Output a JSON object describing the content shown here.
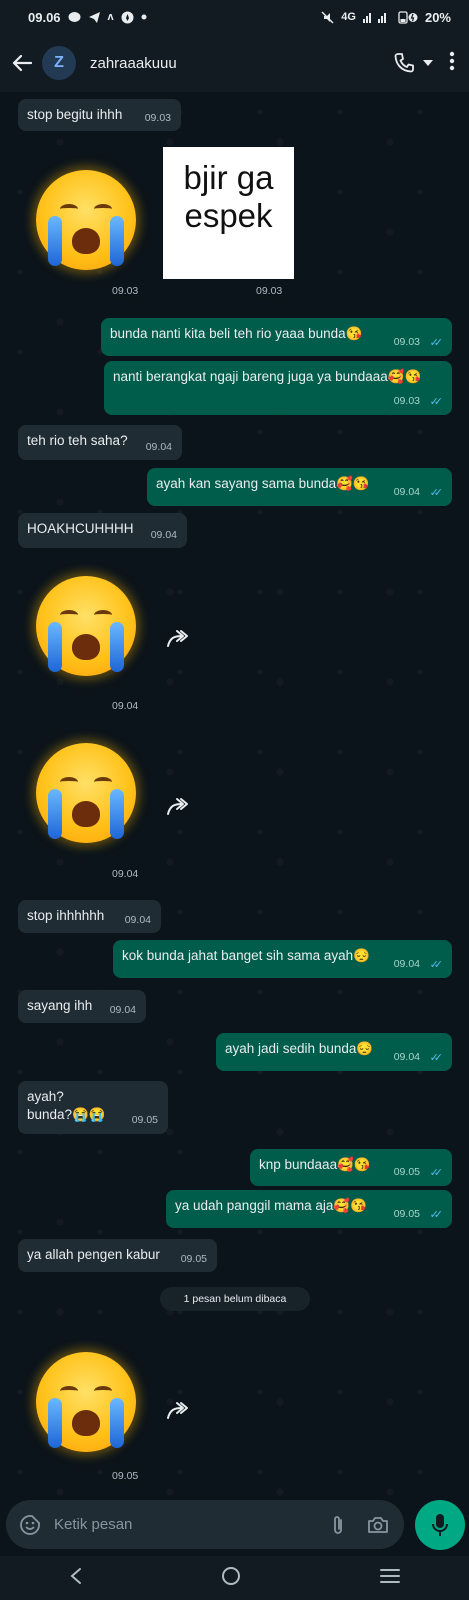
{
  "status_bar": {
    "time": "09.06",
    "network": "4G",
    "battery": "20%",
    "icons": [
      "chat-bubble-icon",
      "telegram-icon",
      "nfc-icon",
      "compass-icon",
      "dot-icon",
      "mute-icon",
      "signal-icon",
      "battery-icon"
    ]
  },
  "header": {
    "avatar_letter": "Z",
    "contact_name": "zahraaakuuu",
    "icons": [
      "back-arrow-icon",
      "phone-icon",
      "dropdown-icon",
      "more-vert-icon"
    ]
  },
  "sticker": {
    "line1": "bjir ga",
    "line2": "espek"
  },
  "messages": [
    {
      "text": "stop begitu ihhh",
      "time": "09.03"
    },
    {
      "time": "09.03"
    },
    {
      "time": "09.03"
    },
    {
      "text": "bunda nanti kita beli teh rio yaaa bunda😘",
      "time": "09.03"
    },
    {
      "text": "nanti berangkat ngaji bareng juga ya bundaaa🥰😘",
      "time": "09.03"
    },
    {
      "text": "teh rio teh saha?",
      "time": "09.04"
    },
    {
      "text": "ayah kan sayang sama bunda🥰😘",
      "time": "09.04"
    },
    {
      "text": "HOAKHCUHHHH",
      "time": "09.04"
    },
    {
      "time": "09.04"
    },
    {
      "time": "09.04"
    },
    {
      "text": "stop ihhhhhh",
      "time": "09.04"
    },
    {
      "text": "kok bunda jahat banget sih sama ayah😔",
      "time": "09.04"
    },
    {
      "text": "sayang ihh",
      "time": "09.04"
    },
    {
      "text": "ayah jadi sedih bunda😔",
      "time": "09.04"
    },
    {
      "line1": "ayah?",
      "line2": "bunda?😭😭",
      "time": "09.05"
    },
    {
      "text": "knp bundaaa🥰😘",
      "time": "09.05"
    },
    {
      "text": "ya udah panggil mama aja🥰😘",
      "time": "09.05"
    },
    {
      "text": "ya allah pengen kabur",
      "time": "09.05"
    },
    {
      "time": "09.05"
    }
  ],
  "unread_banner": "1 pesan belum dibaca",
  "composer": {
    "placeholder": "Ketik pesan"
  },
  "colors": {
    "accent": "#00a884",
    "outgoing": "#005c4b",
    "incoming": "#202c33",
    "read_tick": "#53bdeb"
  }
}
